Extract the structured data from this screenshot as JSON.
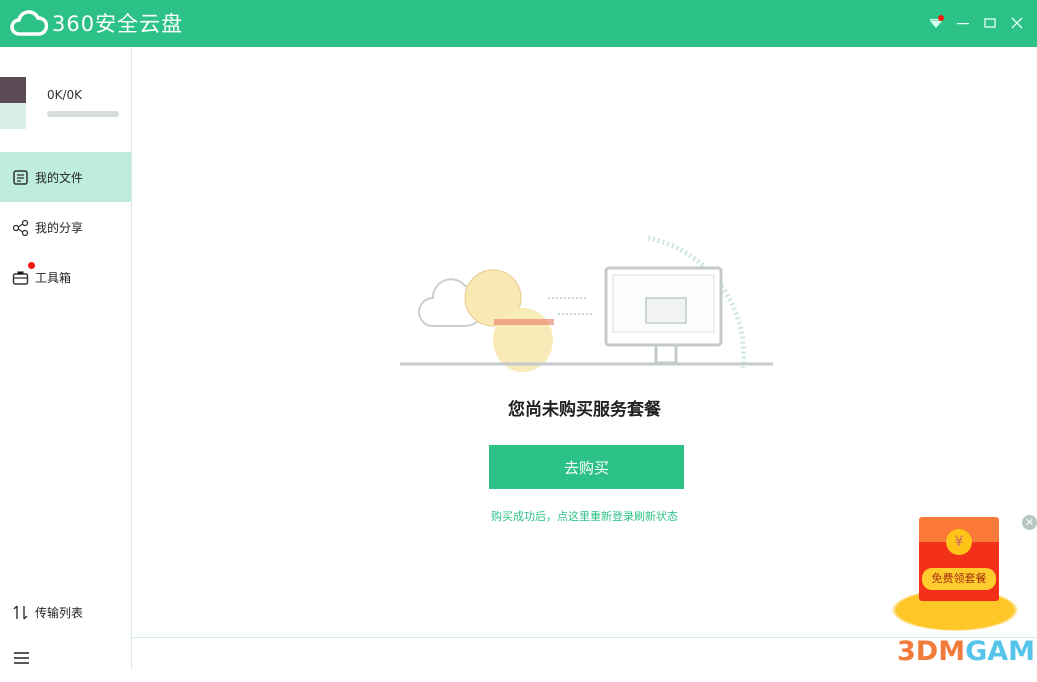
{
  "app": {
    "title": "360安全云盘"
  },
  "window": {
    "controls": [
      "menu",
      "minimize",
      "maximize",
      "close"
    ]
  },
  "user": {
    "quota": "0K/0K",
    "quota_fraction": 0
  },
  "sidebar": {
    "items": [
      {
        "label": "我的文件",
        "active": true
      },
      {
        "label": "我的分享"
      },
      {
        "label": "工具箱",
        "badge": true
      }
    ],
    "transfer_label": "传输列表"
  },
  "main": {
    "title": "您尚未购买服务套餐",
    "buy_label": "去购买",
    "hint_prefix": "购买成功后，点这里重新登录",
    "hint_link": "刷新状态"
  },
  "promo": {
    "label": "免费领套餐",
    "coin": "¥"
  },
  "watermark": {
    "a": "3DM",
    "b": "GAME"
  },
  "colors": {
    "brand": "#2cc287",
    "active_bg": "#bfeddc",
    "badge": "#f21b0c"
  }
}
